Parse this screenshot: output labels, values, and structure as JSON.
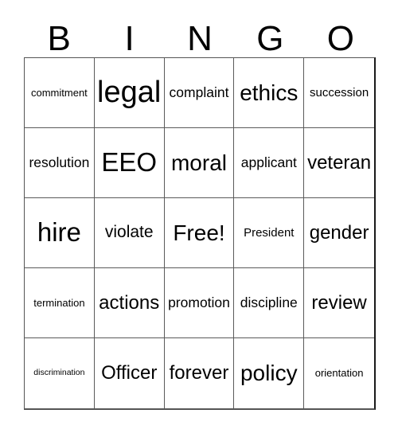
{
  "card": {
    "header_letters": [
      "B",
      "I",
      "N",
      "G",
      "O"
    ],
    "grid": [
      [
        {
          "text": "commitment",
          "size": "s-sm"
        },
        {
          "text": "legal",
          "size": "s-5xl"
        },
        {
          "text": "complaint",
          "size": "s-lg"
        },
        {
          "text": "ethics",
          "size": "s-3xl"
        },
        {
          "text": "succession",
          "size": "s-md"
        }
      ],
      [
        {
          "text": "resolution",
          "size": "s-lg"
        },
        {
          "text": "EEO",
          "size": "s-4xl"
        },
        {
          "text": "moral",
          "size": "s-3xl"
        },
        {
          "text": "applicant",
          "size": "s-lg"
        },
        {
          "text": "veteran",
          "size": "s-2xl"
        }
      ],
      [
        {
          "text": "hire",
          "size": "s-4xl"
        },
        {
          "text": "violate",
          "size": "s-xl"
        },
        {
          "text": "Free!",
          "size": "s-3xl"
        },
        {
          "text": "President",
          "size": "s-md"
        },
        {
          "text": "gender",
          "size": "s-2xl"
        }
      ],
      [
        {
          "text": "termination",
          "size": "s-sm"
        },
        {
          "text": "actions",
          "size": "s-2xl"
        },
        {
          "text": "promotion",
          "size": "s-lg"
        },
        {
          "text": "discipline",
          "size": "s-lg"
        },
        {
          "text": "review",
          "size": "s-2xl"
        }
      ],
      [
        {
          "text": "discrimination",
          "size": "s-xs"
        },
        {
          "text": "Officer",
          "size": "s-2xl"
        },
        {
          "text": "forever",
          "size": "s-2xl"
        },
        {
          "text": "policy",
          "size": "s-3xl"
        },
        {
          "text": "orientation",
          "size": "s-sm"
        }
      ]
    ],
    "colors": {
      "background": "#ffffff",
      "text": "#000000",
      "grid_line": "#5a5a5a",
      "grid_outer": "#1a1a1a"
    }
  }
}
